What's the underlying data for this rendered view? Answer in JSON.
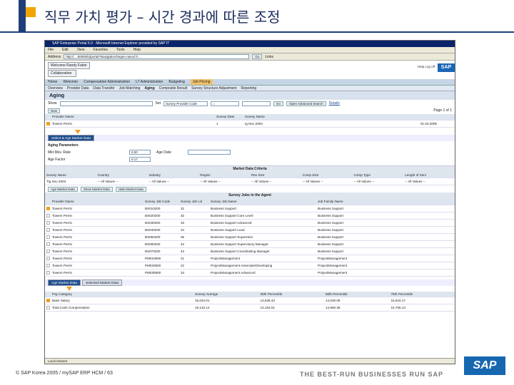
{
  "slide": {
    "title": "직무 가치 평가 – 시간 경과에 따른 조정",
    "footer_left": "© SAP Korea 2005 / mySAP ERP HCM / 63",
    "footer_right": "THE BEST-RUN BUSINESSES RUN SAP",
    "logo": "SAP"
  },
  "browser": {
    "title": "SAP Enterprise Portal 6.0 - Microsoft Internet Explorer provided by SAP IT",
    "menu": [
      "File",
      "Edit",
      "View",
      "Favorites",
      "Tools",
      "Help"
    ],
    "address_label": "Address",
    "address": "http://...:50000/irj/portal?NavigationTarget=navurl://...",
    "go": "Go",
    "links": "Links",
    "status": "Local intranet"
  },
  "portal": {
    "welcome": "Welcome Randy Fabin",
    "collaboration": "Collaboration",
    "util": "Help  Log off",
    "logo": "SAP",
    "nav1": [
      "Home",
      "Welcome",
      "Compensation Administration",
      "LT Administration",
      "Budgeting",
      "Job Pricing"
    ],
    "nav1_active": "Job Pricing",
    "nav2": [
      "Overview",
      "Provider Data",
      "Data Transfer",
      "Job Matching",
      "Aging",
      "Composite Result",
      "Survey Structure Adjustment",
      "Reporting"
    ],
    "page_title": "Aging",
    "filter": {
      "show_label": "Show",
      "by_label": "Set",
      "field": "Survey Provider Code",
      "op": "=",
      "value": "",
      "go": "Go",
      "open_adv": "Open Advanced Search",
      "details": "Details"
    },
    "top_table": {
      "header": [
        "Provider Name",
        "Survey Date",
        "Survey Name"
      ],
      "rows": [
        [
          "Towers Perrin",
          "1",
          "Ig Nov 2003"
        ]
      ],
      "page": "Page",
      "page_no": "1",
      "of": "of",
      "total": "1",
      "right_date": "01.03.2005",
      "actions_label": "New"
    },
    "tab1": "Select & Age Market Data",
    "params": {
      "title": "Aging Parameters",
      "mm_rate_label": "Mkt Mov. Rate",
      "mm_rate": "0.00",
      "age_factor_label": "Age Factor",
      "age_factor": "0.17",
      "age_date_label": "Age Date",
      "age_date": ""
    },
    "criteria_title": "Market Data Criteria",
    "criteria_cols": [
      "Survey Name",
      "Country",
      "Industry",
      "Region",
      "Rev Size",
      "Comp Size",
      "Comp Type",
      "Length of Serv"
    ],
    "criteria_vals": [
      "Tig Nov 2003",
      "-- All Values --",
      "-- All Values --",
      "-- All Values --",
      "-- All Values --",
      "-- All Values --",
      "-- All Values --",
      "-- All Values --"
    ],
    "buttons": [
      "Age Market Data",
      "Show Market Data",
      "Hide Market Data"
    ],
    "jobs_title": "Survey Jobs in the Agent",
    "jobs_header": [
      "Provider Name",
      "Survey Job Code",
      "Survey Job Lvl",
      "Survey Job Name",
      "Job Family Name"
    ],
    "jobs": [
      [
        "Towers Perrin",
        "BS010200",
        "31",
        "Business Support",
        "Business Support"
      ],
      [
        "Towers Perrin",
        "BS020200",
        "32",
        "Business Support Core Level",
        "Business Support"
      ],
      [
        "Towers Perrin",
        "BS030200",
        "33",
        "Business Support Advanced",
        "Business Support"
      ],
      [
        "Towers Perrin",
        "BS040200",
        "34",
        "Business Support Lead",
        "Business Support"
      ],
      [
        "Towers Perrin",
        "BS050200",
        "35",
        "Business Support Supervisor",
        "Business Support"
      ],
      [
        "Towers Perrin",
        "BS060200",
        "42",
        "Business Support Supervisory Manager",
        "Business Support"
      ],
      [
        "Towers Perrin",
        "BS070200",
        "43",
        "Business Support Coordinating Manager",
        "Business Support"
      ],
      [
        "Towers Perrin",
        "PM010900",
        "21",
        "ProjectManagement",
        "ProjectManagement"
      ],
      [
        "Towers Perrin",
        "PM020900",
        "22",
        "ProjectManagement Associate/Developing",
        "ProjectManagement"
      ],
      [
        "Towers Perrin",
        "PM030900",
        "34",
        "ProjectManagement Advanced",
        "ProjectManagement"
      ]
    ],
    "tabs2": [
      "Age Market Data",
      "Selected Market Data"
    ],
    "results_header": [
      "Pay Category",
      "Survey Average",
      "25th Percentile",
      "50th Percentile",
      "75th Percentile"
    ],
    "results": [
      [
        "Base Salary",
        "15,034.01",
        "13,635.43",
        "14,530.06",
        "15,616.17"
      ],
      [
        "Total Cash Compensation",
        "16,134.14",
        "13,154.51",
        "14,950.36",
        "16,765.13"
      ]
    ]
  }
}
